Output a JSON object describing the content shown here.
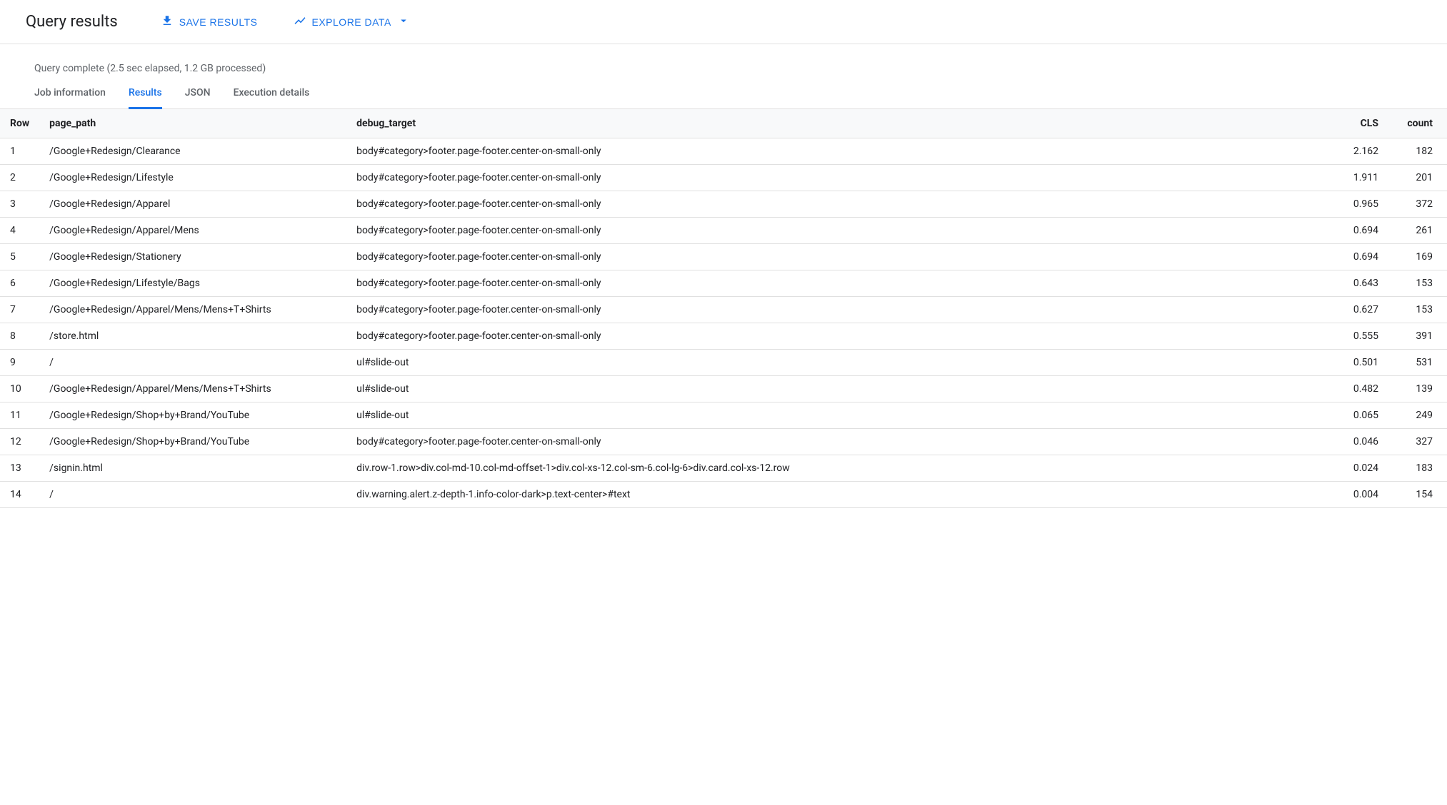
{
  "header": {
    "title": "Query results",
    "save_label": "SAVE RESULTS",
    "explore_label": "EXPLORE DATA"
  },
  "status": {
    "text": "Query complete (2.5 sec elapsed, 1.2 GB processed)"
  },
  "tabs": [
    {
      "id": "job",
      "label": "Job information",
      "active": false
    },
    {
      "id": "results",
      "label": "Results",
      "active": true
    },
    {
      "id": "json",
      "label": "JSON",
      "active": false
    },
    {
      "id": "execution",
      "label": "Execution details",
      "active": false
    }
  ],
  "columns": {
    "row": "Row",
    "page_path": "page_path",
    "debug_target": "debug_target",
    "cls": "CLS",
    "count": "count"
  },
  "rows": [
    {
      "row": "1",
      "page_path": "/Google+Redesign/Clearance",
      "debug_target": "body#category>footer.page-footer.center-on-small-only",
      "cls": "2.162",
      "count": "182"
    },
    {
      "row": "2",
      "page_path": "/Google+Redesign/Lifestyle",
      "debug_target": "body#category>footer.page-footer.center-on-small-only",
      "cls": "1.911",
      "count": "201"
    },
    {
      "row": "3",
      "page_path": "/Google+Redesign/Apparel",
      "debug_target": "body#category>footer.page-footer.center-on-small-only",
      "cls": "0.965",
      "count": "372"
    },
    {
      "row": "4",
      "page_path": "/Google+Redesign/Apparel/Mens",
      "debug_target": "body#category>footer.page-footer.center-on-small-only",
      "cls": "0.694",
      "count": "261"
    },
    {
      "row": "5",
      "page_path": "/Google+Redesign/Stationery",
      "debug_target": "body#category>footer.page-footer.center-on-small-only",
      "cls": "0.694",
      "count": "169"
    },
    {
      "row": "6",
      "page_path": "/Google+Redesign/Lifestyle/Bags",
      "debug_target": "body#category>footer.page-footer.center-on-small-only",
      "cls": "0.643",
      "count": "153"
    },
    {
      "row": "7",
      "page_path": "/Google+Redesign/Apparel/Mens/Mens+T+Shirts",
      "debug_target": "body#category>footer.page-footer.center-on-small-only",
      "cls": "0.627",
      "count": "153"
    },
    {
      "row": "8",
      "page_path": "/store.html",
      "debug_target": "body#category>footer.page-footer.center-on-small-only",
      "cls": "0.555",
      "count": "391"
    },
    {
      "row": "9",
      "page_path": "/",
      "debug_target": "ul#slide-out",
      "cls": "0.501",
      "count": "531"
    },
    {
      "row": "10",
      "page_path": "/Google+Redesign/Apparel/Mens/Mens+T+Shirts",
      "debug_target": "ul#slide-out",
      "cls": "0.482",
      "count": "139"
    },
    {
      "row": "11",
      "page_path": "/Google+Redesign/Shop+by+Brand/YouTube",
      "debug_target": "ul#slide-out",
      "cls": "0.065",
      "count": "249"
    },
    {
      "row": "12",
      "page_path": "/Google+Redesign/Shop+by+Brand/YouTube",
      "debug_target": "body#category>footer.page-footer.center-on-small-only",
      "cls": "0.046",
      "count": "327"
    },
    {
      "row": "13",
      "page_path": "/signin.html",
      "debug_target": "div.row-1.row>div.col-md-10.col-md-offset-1>div.col-xs-12.col-sm-6.col-lg-6>div.card.col-xs-12.row",
      "cls": "0.024",
      "count": "183"
    },
    {
      "row": "14",
      "page_path": "/",
      "debug_target": "div.warning.alert.z-depth-1.info-color-dark>p.text-center>#text",
      "cls": "0.004",
      "count": "154"
    }
  ]
}
